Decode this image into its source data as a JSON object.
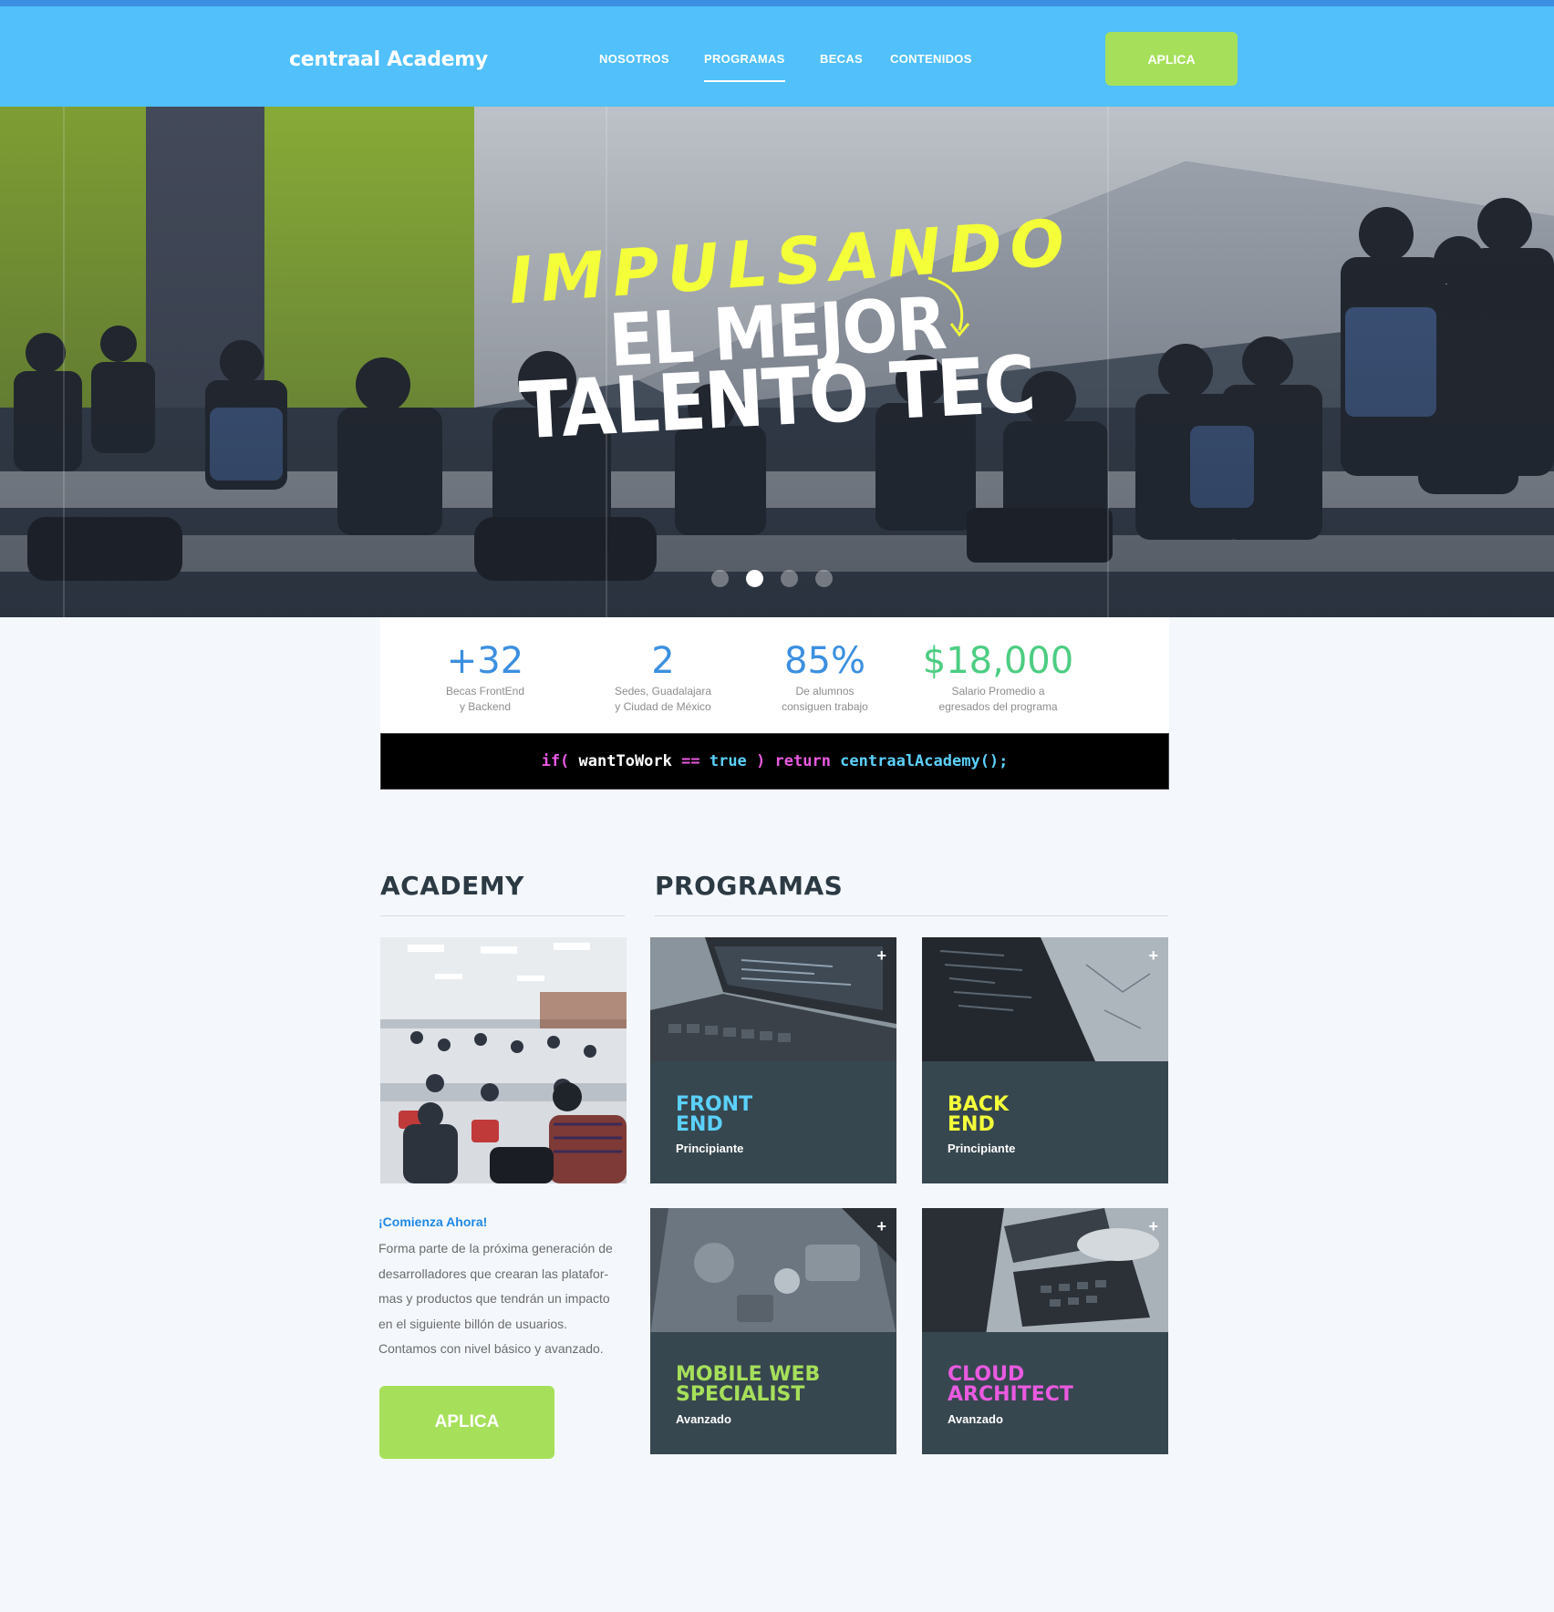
{
  "header": {
    "logo": "centraal Academy",
    "nav": [
      {
        "label": "NOSOTROS"
      },
      {
        "label": "PROGRAMAS"
      },
      {
        "label": "BECAS"
      },
      {
        "label": "CONTENIDOS"
      }
    ],
    "active_nav": "PROGRAMAS",
    "cta_label": "APLICA"
  },
  "hero": {
    "line1": "IMPULSANDO",
    "line2": "EL MEJOR",
    "line3": "TALENTO TEC",
    "slides": 4,
    "active_slide": 2
  },
  "stats": [
    {
      "value": "+32",
      "label1": "Becas FrontEnd",
      "label2": "y Backend",
      "color": "#3b8fe0"
    },
    {
      "value": "2",
      "label1": "Sedes, Guadalajara",
      "label2": "y Ciudad de México",
      "color": "#3b8fe0"
    },
    {
      "value": "85%",
      "label1": "De alumnos",
      "label2": "consiguen trabajo",
      "color": "#3b8fe0"
    },
    {
      "value": "$18,000",
      "label1": "Salario Promedio a",
      "label2": "egresados del programa",
      "color": "#4ccd82"
    }
  ],
  "code": {
    "t1": "if(",
    "t2": " wantToWork ",
    "t3": "==",
    "t4": " true ",
    "t5": ")",
    "t6": " return ",
    "t7": "centraalAcademy();"
  },
  "academy": {
    "heading": "ACADEMY",
    "start": "¡Comienza Ahora!",
    "desc_lines": [
      "Forma parte de la próxima generación de",
      "desarrolladores que crearan las platafor-",
      "mas y productos que tendrán un impacto",
      "en el siguiente billón de usuarios.",
      "Contamos con nivel básico y avanzado."
    ],
    "cta_label": "APLICA"
  },
  "programs": {
    "heading": "PROGRAMAS",
    "cards": [
      {
        "line1": "FRONT",
        "line2": "END",
        "level": "Principiante",
        "color": "#5bd1fb"
      },
      {
        "line1": "BACK",
        "line2": "END",
        "level": "Principiante",
        "color": "#f4ff3a"
      },
      {
        "line1": "MOBILE WEB",
        "line2": "SPECIALIST",
        "level": "Avanzado",
        "color": "#a6e05a"
      },
      {
        "line1": "CLOUD",
        "line2": "ARCHITECT",
        "level": "Avanzado",
        "color": "#e95ae0"
      }
    ],
    "plus_icon": "+"
  }
}
